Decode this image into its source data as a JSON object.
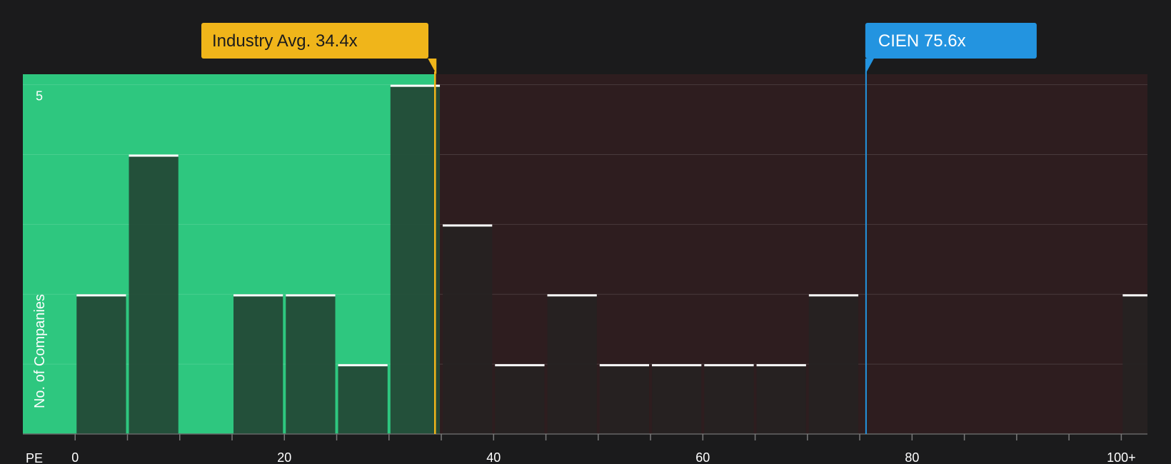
{
  "chart_data": {
    "type": "bar",
    "xlabel": "PE",
    "ylabel": "No. of Companies",
    "xlim": [
      -5,
      102.5
    ],
    "ylim": [
      0,
      5.15
    ],
    "bin_width": 5,
    "x_ticks": [
      0,
      20,
      40,
      60,
      80,
      100
    ],
    "x_tick_labels": [
      "0",
      "20",
      "40",
      "60",
      "80",
      "100+"
    ],
    "y_ticks": [
      5
    ],
    "grid": true,
    "bins": [
      {
        "x": 0,
        "value": 2
      },
      {
        "x": 5,
        "value": 4
      },
      {
        "x": 10,
        "value": 0
      },
      {
        "x": 15,
        "value": 2
      },
      {
        "x": 20,
        "value": 2
      },
      {
        "x": 25,
        "value": 1
      },
      {
        "x": 30,
        "value": 5
      },
      {
        "x": 35,
        "value": 3
      },
      {
        "x": 40,
        "value": 1
      },
      {
        "x": 45,
        "value": 2
      },
      {
        "x": 50,
        "value": 1
      },
      {
        "x": 55,
        "value": 1
      },
      {
        "x": 60,
        "value": 1
      },
      {
        "x": 65,
        "value": 1
      },
      {
        "x": 70,
        "value": 2
      },
      {
        "x": 100,
        "value": 2
      }
    ],
    "industry_avg": {
      "label": "Industry Avg. 34.4x",
      "value": 34.4
    },
    "company": {
      "label": "CIEN 75.6x",
      "value": 75.6
    }
  },
  "colors": {
    "background": "#1b1b1c",
    "below_avg_zone": "#2ec77f",
    "above_avg_zone": "#2e1d1f",
    "industry_marker": "#f0b51a",
    "company_marker": "#2394e0",
    "bar_fill_green": "#234a37",
    "bar_fill_dark": "#262222",
    "bar_cap": "#ffffff"
  }
}
